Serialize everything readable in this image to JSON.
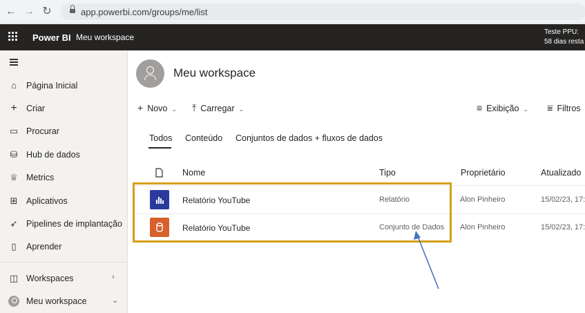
{
  "browser": {
    "url": "app.powerbi.com/groups/me/list"
  },
  "app": {
    "brand": "Power BI",
    "breadcrumb": "Meu workspace",
    "trial_line1": "Teste PPU:",
    "trial_line2": "58 dias resta"
  },
  "sidebar": {
    "items": [
      {
        "label": "Página Inicial",
        "icon": "home-icon"
      },
      {
        "label": "Criar",
        "icon": "plus-icon"
      },
      {
        "label": "Procurar",
        "icon": "folder-icon"
      },
      {
        "label": "Hub de dados",
        "icon": "database-icon"
      },
      {
        "label": "Metrics",
        "icon": "trophy-icon"
      },
      {
        "label": "Aplicativos",
        "icon": "apps-icon"
      },
      {
        "label": "Pipelines de implantação",
        "icon": "rocket-icon"
      },
      {
        "label": "Aprender",
        "icon": "book-icon"
      }
    ],
    "workspaces": "Workspaces",
    "my_workspace": "Meu workspace"
  },
  "main": {
    "title": "Meu workspace",
    "toolbar": {
      "new": "Novo",
      "upload": "Carregar",
      "view": "Exibição",
      "filters": "Filtros"
    },
    "tabs": [
      "Todos",
      "Conteúdo",
      "Conjuntos de dados + fluxos de dados"
    ],
    "columns": {
      "name": "Nome",
      "type": "Tipo",
      "owner": "Proprietário",
      "updated": "Atualizado"
    },
    "rows": [
      {
        "name": "Relatório YouTube",
        "type": "Relatório",
        "owner": "Alon Pinheiro",
        "updated": "15/02/23, 17:",
        "icon": "report-icon",
        "icon_color": "#2b3a9d"
      },
      {
        "name": "Relatório YouTube",
        "type": "Conjunto de Dados",
        "owner": "Alon Pinheiro",
        "updated": "15/02/23, 17:",
        "icon": "dataset-icon",
        "icon_color": "#d8602b"
      }
    ]
  },
  "colors": {
    "highlight": "#d4a017",
    "annotation_arrow": "#4472c4"
  }
}
